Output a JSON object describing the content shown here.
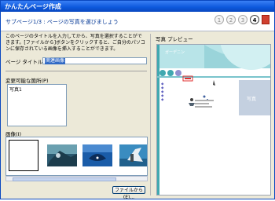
{
  "window": {
    "title": "かんたんページ作成"
  },
  "header": {
    "subtitle": "サブページ1/3 : ページの写真を選びましょう",
    "steps": [
      "1",
      "2",
      "3",
      "4"
    ],
    "active_step": "4"
  },
  "left": {
    "instructions": "このページのタイトルを入力してから、写真を選択することができます。[ファイルから]ボタンをクリックすると、ご自分のパソコンに保存されている画像を挿入することができます。",
    "title_label": "ページ タイトル(T)",
    "title_value": "関連画像",
    "editable_label": "変更可能な箇所(P)",
    "editable_value": "写真1",
    "images_label": "画像(I)",
    "file_button": "ファイルから(E)..."
  },
  "right": {
    "preview_label": "写真 プレビュー",
    "banner_text": "ガーデニン",
    "side_links": [
      "◆",
      "◆",
      "◆",
      "◆",
      "◆"
    ],
    "photo_label": "写真"
  },
  "colors": {
    "accent": "#0a48c0",
    "banner": "#b8e4e8",
    "teal": "#40a8b0",
    "purple": "#9090d0"
  }
}
